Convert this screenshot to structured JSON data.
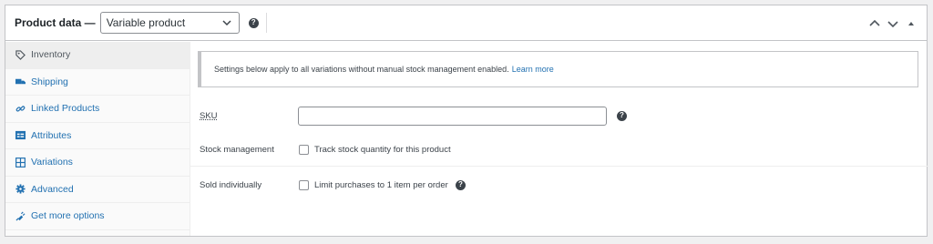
{
  "header": {
    "title": "Product data —",
    "product_type": "Variable product"
  },
  "tabs": [
    {
      "label": "Inventory",
      "icon": "tag-icon"
    },
    {
      "label": "Shipping",
      "icon": "truck-icon"
    },
    {
      "label": "Linked Products",
      "icon": "link-icon"
    },
    {
      "label": "Attributes",
      "icon": "list-icon"
    },
    {
      "label": "Variations",
      "icon": "grid-icon"
    },
    {
      "label": "Advanced",
      "icon": "gear-icon"
    },
    {
      "label": "Get more options",
      "icon": "plugin-icon"
    }
  ],
  "notice": {
    "text": "Settings below apply to all variations without manual stock management enabled.",
    "link": "Learn more"
  },
  "fields": {
    "sku_label": "SKU",
    "sku_value": "",
    "stock_label": "Stock management",
    "stock_checkbox": "Track stock quantity for this product",
    "sold_label": "Sold individually",
    "sold_checkbox": "Limit purchases to 1 item per order"
  },
  "help_glyph": "?",
  "colors": {
    "link": "#2271b1",
    "border": "#c3c4c7",
    "sidebar_bg": "#fafafa",
    "active_tab_bg": "#eeeeee"
  }
}
